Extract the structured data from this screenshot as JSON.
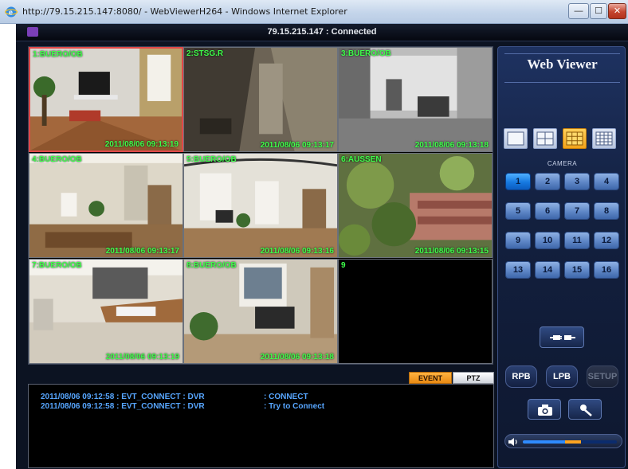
{
  "window": {
    "title": "http://79.15.215.147:8080/ - WebViewerH264 - Windows Internet Explorer",
    "controls": [
      "minimize-icon",
      "maximize-icon",
      "close-icon"
    ]
  },
  "app": {
    "connection_status": "79.15.215.147 : Connected"
  },
  "cameras": [
    {
      "label": "1:BUERO/OB",
      "timestamp": "2011/08/06 09:13:19",
      "selected": true
    },
    {
      "label": "2:STSG.R",
      "timestamp": "2011/08/06 09:13:17",
      "selected": false
    },
    {
      "label": "3:BUERO/OB",
      "timestamp": "2011/08/06 09:13:18",
      "selected": false
    },
    {
      "label": "4:BUERO/OB",
      "timestamp": "2011/08/06 09:13:17",
      "selected": false
    },
    {
      "label": "5:BUERO/OB",
      "timestamp": "2011/08/06 09:13:16",
      "selected": false
    },
    {
      "label": "6:AUSSEN",
      "timestamp": "2011/08/06 09:13:15",
      "selected": false
    },
    {
      "label": "7:BUERO/OB",
      "timestamp": "2011/08/06 09:13:19",
      "selected": false
    },
    {
      "label": "8:BUERO/OB",
      "timestamp": "2011/08/06 09:13:18",
      "selected": false
    },
    {
      "label": "9",
      "timestamp": "",
      "selected": false
    }
  ],
  "tabs": {
    "event": "EVENT",
    "ptz": "PTZ",
    "active": "event"
  },
  "event_log": [
    {
      "message": "2011/08/06 09:12:58 : EVT_CONNECT : DVR",
      "result": ": CONNECT"
    },
    {
      "message": "2011/08/06 09:12:58 : EVT_CONNECT : DVR",
      "result": ": Try to Connect"
    }
  ],
  "panel": {
    "title": "Web Viewer",
    "layout_buttons": [
      {
        "name": "layout-1x1-button",
        "active": false
      },
      {
        "name": "layout-2x2-button",
        "active": false
      },
      {
        "name": "layout-3x3-button",
        "active": true
      },
      {
        "name": "layout-4x4-button",
        "active": false
      }
    ],
    "camera_caption": "CAMERA",
    "camera_buttons": [
      "1",
      "2",
      "3",
      "4",
      "5",
      "6",
      "7",
      "8",
      "9",
      "10",
      "11",
      "12",
      "13",
      "14",
      "15",
      "16"
    ],
    "active_camera": "1",
    "playback": {
      "rpb": "RPB",
      "lpb": "LPB",
      "setup": "SETUP"
    },
    "icons": {
      "connect": "plug-connect-icon",
      "snapshot": "camera-snapshot-icon",
      "microphone": "microphone-icon",
      "speaker": "speaker-icon"
    },
    "volume": {
      "level": 0.62,
      "highlight_start": 0.45
    }
  },
  "colors": {
    "overlay_text": "#3eff4a",
    "log_text": "#57a6ff",
    "selected_border": "#e04848",
    "event_tab": "#f5a026"
  }
}
